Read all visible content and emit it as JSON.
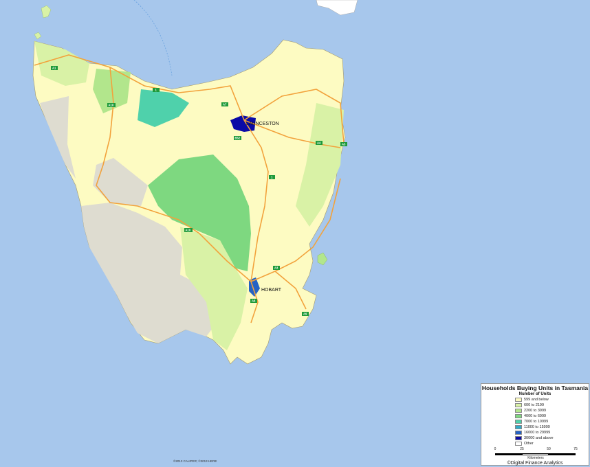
{
  "map": {
    "type": "choropleth",
    "region": "Tasmania",
    "background_color": "#a7c7ec",
    "land_other_color": "#dedcd0",
    "road_color": "#f2a23c",
    "cities": [
      {
        "name": "LAUNCESTON"
      },
      {
        "name": "HOBART"
      }
    ],
    "routes": [
      "A1",
      "1",
      "A10",
      "A7",
      "B52",
      "A4",
      "A3",
      "1",
      "A10",
      "A3",
      "A6",
      "A9"
    ]
  },
  "legend": {
    "title": "Households Buying Units in Tasmania",
    "subtitle": "Number of Units",
    "classes": [
      {
        "label": "599 and below",
        "color": "#fdfbc2"
      },
      {
        "label": "600 to 2199",
        "color": "#d9f2a6"
      },
      {
        "label": "2200 to 3999",
        "color": "#b2e68c"
      },
      {
        "label": "4000 to 6999",
        "color": "#7ed880"
      },
      {
        "label": "7000 to 10999",
        "color": "#4fd1ab"
      },
      {
        "label": "11000 to 15999",
        "color": "#30aac8"
      },
      {
        "label": "16000 to 29999",
        "color": "#2563c4"
      },
      {
        "label": "30000 and above",
        "color": "#0a0aa6"
      },
      {
        "label": "Other",
        "color": "#ffffff"
      }
    ],
    "scale": {
      "ticks": [
        "0",
        "25",
        "50",
        "75"
      ],
      "unit": "Kilometers"
    },
    "credit": "©Digital Finance Analytics"
  },
  "copyright": "©2013 CALIPER; ©2013 HERE"
}
